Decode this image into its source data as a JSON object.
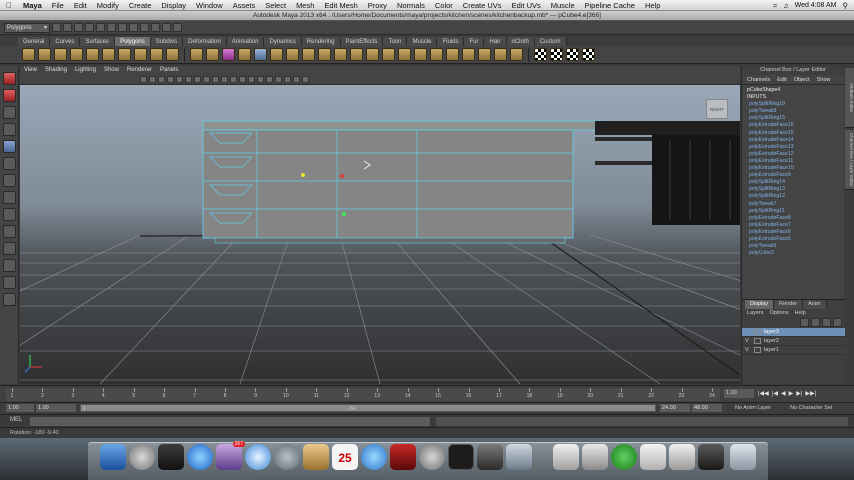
{
  "menubar": {
    "app_name": "Maya",
    "items": [
      "File",
      "Edit",
      "Modify",
      "Create",
      "Display",
      "Window",
      "Assets",
      "Select",
      "Mesh",
      "Edit Mesh",
      "Proxy",
      "Normals",
      "Color",
      "Create UVs",
      "Edit UVs",
      "Muscle",
      "Pipeline Cache",
      "Help"
    ],
    "clock": "Wed 4:08 AM"
  },
  "window_title": "Autodesk Maya 2013 x64 : /Users/Home/Documents/maya/projects/kitchen/scenes/kitchenbackup.mb* --- pCube4.e[366]",
  "status_line": {
    "mode_menu": "Polygons"
  },
  "shelf": {
    "tabs": [
      "General",
      "Curves",
      "Surfaces",
      "Polygons",
      "Subdivs",
      "Deformation",
      "Animation",
      "Dynamics",
      "Rendering",
      "PaintEffects",
      "Toon",
      "Muscle",
      "Fluids",
      "Fur",
      "Hair",
      "nCloth",
      "Custom"
    ],
    "active_tab": "Polygons"
  },
  "viewport": {
    "menu": [
      "View",
      "Shading",
      "Lighting",
      "Show",
      "Renderer",
      "Panels"
    ],
    "viewcube_label": "RIGHT"
  },
  "channel_box": {
    "title": "Channel Box / Layer Editor",
    "menu": [
      "Channels",
      "Edit",
      "Object",
      "Show"
    ],
    "shape_node": "pCubeShape4",
    "inputs_label": "INPUTS",
    "inputs": [
      "polySplitRing19",
      "polyTweak8",
      "polySplitRing15",
      "polyExtrudeFace16",
      "polyExtrudeFace15",
      "polyExtrudeFace14",
      "polyExtrudeFace13",
      "polyExtrudeFace12",
      "polyExtrudeFace11",
      "polyExtrudeFace10",
      "polyExtrudeFace9",
      "polySplitRing14",
      "polySplitRing13",
      "polySplitRing12",
      "polyTweak7",
      "polySplitRing11",
      "polyExtrudeFace8",
      "polyExtrudeFace7",
      "polyExtrudeFace6",
      "polyExtrudeFace5",
      "polyTweak6",
      "polyCube3"
    ]
  },
  "layer_editor": {
    "tabs": [
      "Display",
      "Render",
      "Anim"
    ],
    "active_tab": "Display",
    "menu": [
      "Layers",
      "Options",
      "Help"
    ],
    "layers": [
      {
        "vis": "",
        "name": "layer3",
        "selected": true
      },
      {
        "vis": "V",
        "name": "layer2",
        "selected": false
      },
      {
        "vis": "V",
        "name": "layer1",
        "selected": false
      }
    ]
  },
  "side_tabs": [
    "Attribute Editor",
    "Channel Box / Layer Editor"
  ],
  "time_slider": {
    "ticks": [
      "1",
      "2",
      "3",
      "4",
      "5",
      "6",
      "7",
      "8",
      "9",
      "10",
      "11",
      "12",
      "13",
      "14",
      "15",
      "16",
      "17",
      "18",
      "19",
      "20",
      "21",
      "22",
      "23",
      "24"
    ],
    "current_frame": "1.00"
  },
  "range_slider": {
    "start_time": "1.00",
    "playback_start": "1.00",
    "bar_start": "1",
    "bar_end": "24",
    "playback_end": "24.00",
    "end_time": "48.00",
    "anim_layer": "No Anim Layer",
    "character_set": "No Character Set"
  },
  "command_line": {
    "label": "MEL"
  },
  "help_line": "Rotation:   -180    -9.40",
  "dock": {
    "calendar_day": "25",
    "mail_badge": "267"
  }
}
